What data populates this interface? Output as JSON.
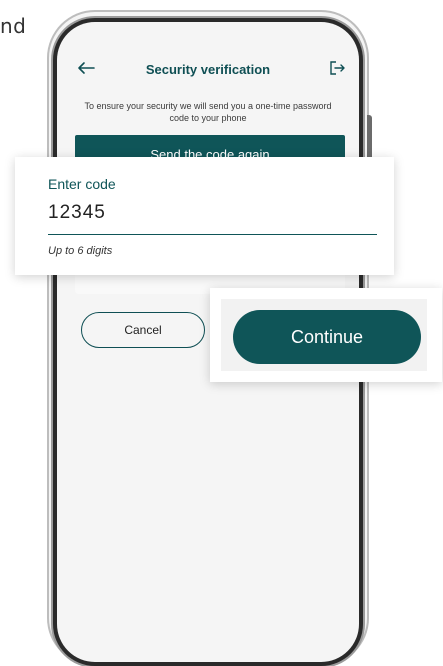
{
  "partial_text": "nd",
  "header": {
    "title": "Security verification",
    "back_icon": "arrow-left-icon",
    "logout_icon": "logout-icon"
  },
  "subtitle": "To ensure your security we will send you a one-time password code to your phone",
  "send_again_label": "Send the code again",
  "code_field": {
    "label": "Enter code",
    "value": "12345",
    "hint": "Up to 6 digits"
  },
  "buttons": {
    "cancel_label": "Cancel",
    "continue_label": "Continue"
  },
  "colors": {
    "primary": "#0f5558",
    "background": "#f5f5f5"
  }
}
